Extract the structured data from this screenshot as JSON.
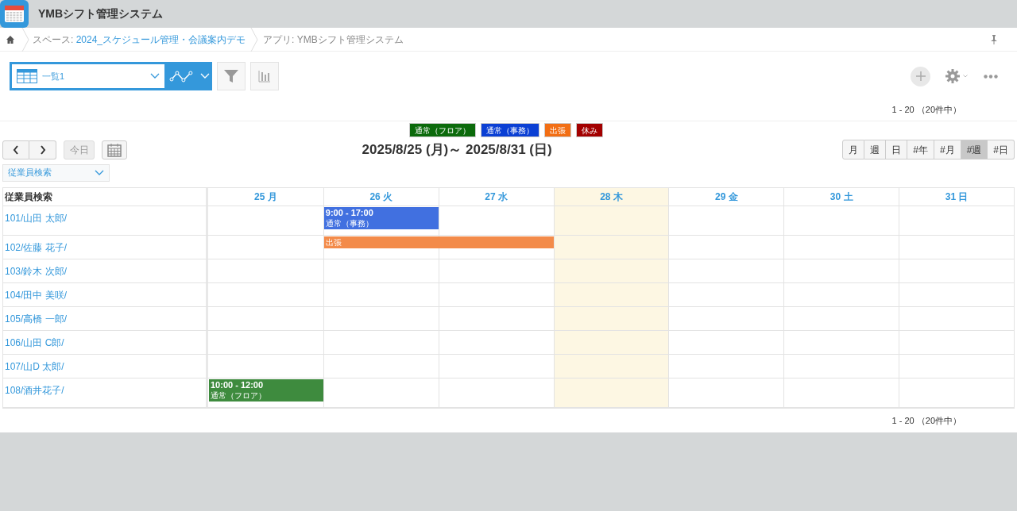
{
  "app": {
    "title": "YMBシフト管理システム"
  },
  "breadcrumb": {
    "space_prefix": "スペース: ",
    "space": "2024_スケジュール管理・会議案内デモ",
    "app": "アプリ: YMBシフト管理システム"
  },
  "view_select": {
    "value": "一覧1"
  },
  "count_top": "1 - 20 （20件中）",
  "legend": [
    {
      "label": "通常（フロア）",
      "color": "#0b6a0b"
    },
    {
      "label": "通常（事務）",
      "color": "#0a3fd4"
    },
    {
      "label": "出張",
      "color": "#f26e14"
    },
    {
      "label": "休み",
      "color": "#a30000"
    }
  ],
  "nav": {
    "today": "今日",
    "range": "2025/8/25 (月)～ 2025/8/31 (日)"
  },
  "view_buttons": [
    {
      "label": "月",
      "selected": false
    },
    {
      "label": "週",
      "selected": false
    },
    {
      "label": "日",
      "selected": false
    },
    {
      "label": "#年",
      "selected": false
    },
    {
      "label": "#月",
      "selected": false
    },
    {
      "label": "#週",
      "selected": true
    },
    {
      "label": "#日",
      "selected": false
    }
  ],
  "employee_filter": {
    "placeholder": "従業員検索"
  },
  "table": {
    "name_header": "従業員検索",
    "days": [
      {
        "label": "25 月",
        "today": false
      },
      {
        "label": "26 火",
        "today": false
      },
      {
        "label": "27 水",
        "today": false
      },
      {
        "label": "28 木",
        "today": true
      },
      {
        "label": "29 金",
        "today": false
      },
      {
        "label": "30 土",
        "today": false
      },
      {
        "label": "31 日",
        "today": false
      }
    ],
    "rows": [
      {
        "name": "101/山田 太郎/",
        "cells": [
          {
            "kind": "empty"
          },
          {
            "kind": "event",
            "time": "9:00 - 17:00",
            "label": "通常（事務）",
            "color": "#4170e0"
          },
          {
            "kind": "empty"
          },
          {
            "kind": "empty"
          },
          {
            "kind": "empty"
          },
          {
            "kind": "empty"
          },
          {
            "kind": "empty"
          }
        ]
      },
      {
        "name": "102/佐藤 花子/",
        "cells": [
          {
            "kind": "empty"
          },
          {
            "kind": "event",
            "label": "出張",
            "color": "#f38b4a"
          },
          {
            "kind": "covered"
          },
          {
            "kind": "empty"
          },
          {
            "kind": "empty"
          },
          {
            "kind": "empty"
          },
          {
            "kind": "empty"
          }
        ]
      },
      {
        "name": "103/鈴木 次郎/",
        "cells": [
          {
            "kind": "empty"
          },
          {
            "kind": "empty"
          },
          {
            "kind": "empty"
          },
          {
            "kind": "empty"
          },
          {
            "kind": "empty"
          },
          {
            "kind": "empty"
          },
          {
            "kind": "empty"
          }
        ]
      },
      {
        "name": "104/田中 美咲/",
        "cells": [
          {
            "kind": "empty"
          },
          {
            "kind": "empty"
          },
          {
            "kind": "empty"
          },
          {
            "kind": "empty"
          },
          {
            "kind": "empty"
          },
          {
            "kind": "empty"
          },
          {
            "kind": "empty"
          }
        ]
      },
      {
        "name": "105/高橋 一郎/",
        "cells": [
          {
            "kind": "empty"
          },
          {
            "kind": "empty"
          },
          {
            "kind": "empty"
          },
          {
            "kind": "empty"
          },
          {
            "kind": "empty"
          },
          {
            "kind": "empty"
          },
          {
            "kind": "empty"
          }
        ]
      },
      {
        "name": "106/山田 C郎/",
        "cells": [
          {
            "kind": "empty"
          },
          {
            "kind": "empty"
          },
          {
            "kind": "empty"
          },
          {
            "kind": "empty"
          },
          {
            "kind": "empty"
          },
          {
            "kind": "empty"
          },
          {
            "kind": "empty"
          }
        ]
      },
      {
        "name": "107/山D 太郎/",
        "cells": [
          {
            "kind": "empty"
          },
          {
            "kind": "empty"
          },
          {
            "kind": "empty"
          },
          {
            "kind": "empty"
          },
          {
            "kind": "empty"
          },
          {
            "kind": "empty"
          },
          {
            "kind": "empty"
          }
        ]
      },
      {
        "name": "108/酒井花子/",
        "cells": [
          {
            "kind": "event",
            "time": "10:00 - 12:00",
            "label": "通常（フロア）",
            "color": "#3e8b3e"
          },
          {
            "kind": "empty"
          },
          {
            "kind": "empty"
          },
          {
            "kind": "empty"
          },
          {
            "kind": "empty"
          },
          {
            "kind": "empty"
          },
          {
            "kind": "empty"
          }
        ]
      }
    ]
  },
  "count_bottom": "1 - 20 （20件中）"
}
